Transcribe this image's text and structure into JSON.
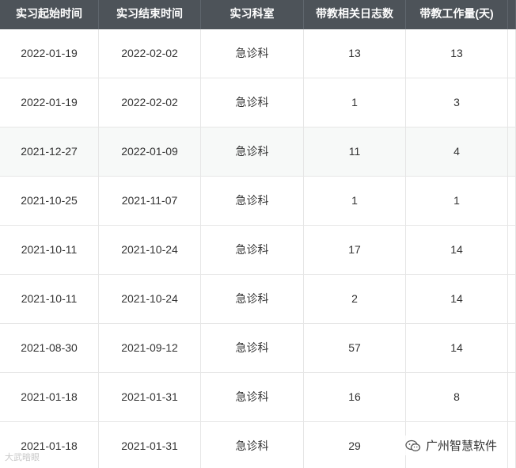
{
  "table": {
    "headers": [
      "实习起始时间",
      "实习结束时间",
      "实习科室",
      "带教相关日志数",
      "带教工作量(天)"
    ],
    "rows": [
      [
        "2022-01-19",
        "2022-02-02",
        "急诊科",
        "13",
        "13"
      ],
      [
        "2022-01-19",
        "2022-02-02",
        "急诊科",
        "1",
        "3"
      ],
      [
        "2021-12-27",
        "2022-01-09",
        "急诊科",
        "11",
        "4"
      ],
      [
        "2021-10-25",
        "2021-11-07",
        "急诊科",
        "1",
        "1"
      ],
      [
        "2021-10-11",
        "2021-10-24",
        "急诊科",
        "17",
        "14"
      ],
      [
        "2021-10-11",
        "2021-10-24",
        "急诊科",
        "2",
        "14"
      ],
      [
        "2021-08-30",
        "2021-09-12",
        "急诊科",
        "57",
        "14"
      ],
      [
        "2021-01-18",
        "2021-01-31",
        "急诊科",
        "16",
        "8"
      ],
      [
        "2021-01-18",
        "2021-01-31",
        "急诊科",
        "29",
        ""
      ]
    ]
  },
  "watermarks": {
    "left_text": "大武暗眼",
    "right_text": "广州智慧软件",
    "right_icon": "wechat-icon"
  },
  "colors": {
    "header_bg": "#4d5359",
    "header_text": "#ffffff",
    "alt_row_bg": "#f7f9f8",
    "border": "#e6e6e6"
  }
}
